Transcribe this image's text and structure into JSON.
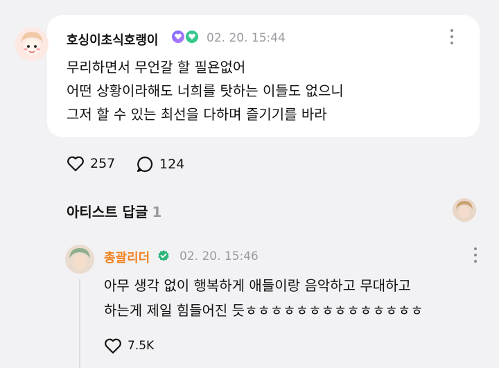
{
  "post": {
    "username": "호싱이초식호랭이",
    "timestamp": "02. 20. 15:44",
    "lines": [
      "무리하면서 무언갈 할 필욘없어",
      "어떤 상황이라해도 너희를 탓하는 이들도 없으니",
      "그저 할 수 있는 최선을 다하며 즐기기를 바라"
    ],
    "likes": "257",
    "comments": "124"
  },
  "artist_replies": {
    "title": "아티스트 답글",
    "count": "1"
  },
  "reply": {
    "name": "총괄리더",
    "timestamp": "02. 20. 15:46",
    "lines": [
      "아무 생각 없이 행복하게 애들이랑 음악하고 무대하고",
      "하는게 제일 힘들어진 듯ㅎㅎㅎㅎㅎㅎㅎㅎㅎㅎㅎㅎㅎㅎ"
    ],
    "likes": "7.5K"
  },
  "colors": {
    "background": "#f2f2f4",
    "card": "#ffffff",
    "artist_name": "#f0821e",
    "muted": "#9a9aa0",
    "verified": "#2fb67a"
  },
  "icons": [
    "heart-icon",
    "comment-icon",
    "more-icon",
    "verified-icon",
    "fan-badge-icon"
  ]
}
